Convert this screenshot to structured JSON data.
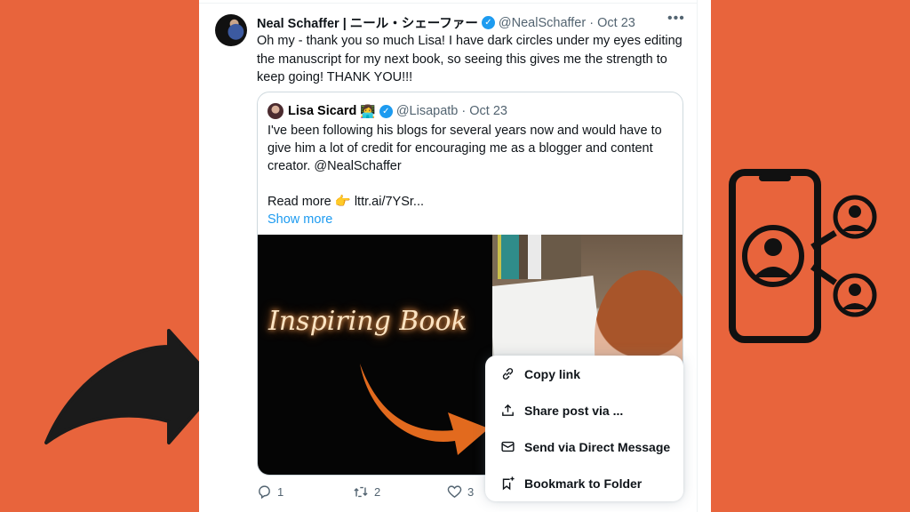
{
  "tweet": {
    "author_name": "Neal Schaffer | ニール・シェーファー",
    "verified_icon": "verified-badge-icon",
    "handle": "@NealSchaffer",
    "separator": "·",
    "date": "Oct 23",
    "more_icon": "•••",
    "text": "Oh my - thank you so much Lisa! I have dark circles under my eyes editing the manuscript for my next book, so seeing this gives me the strength to keep going! THANK YOU!!!"
  },
  "quote": {
    "author_name": "Lisa Sicard",
    "emoji": "👩‍💻",
    "handle": "@Lisapatb",
    "separator": "·",
    "date": "Oct 23",
    "text": "I've been following his blogs for several years now and would have to give him a lot of credit for encouraging me as a blogger and content creator. @NealSchaffer",
    "read_more": "Read more 👉 lttr.ai/7YSr...",
    "show_more": "Show more",
    "media_caption": "Inspiring Book"
  },
  "actions": {
    "replies": "1",
    "reposts": "2",
    "likes": "3"
  },
  "share_menu": {
    "items": [
      {
        "label": "Copy link",
        "icon": "link-icon"
      },
      {
        "label": "Share post via ...",
        "icon": "share-upload-icon"
      },
      {
        "label": "Send via Direct Message",
        "icon": "envelope-icon"
      },
      {
        "label": "Bookmark to Folder",
        "icon": "bookmark-add-icon"
      }
    ]
  },
  "colors": {
    "background": "#e8643c",
    "accent_blue": "#1d9bf0",
    "text_primary": "#0f1419",
    "text_secondary": "#536471"
  }
}
